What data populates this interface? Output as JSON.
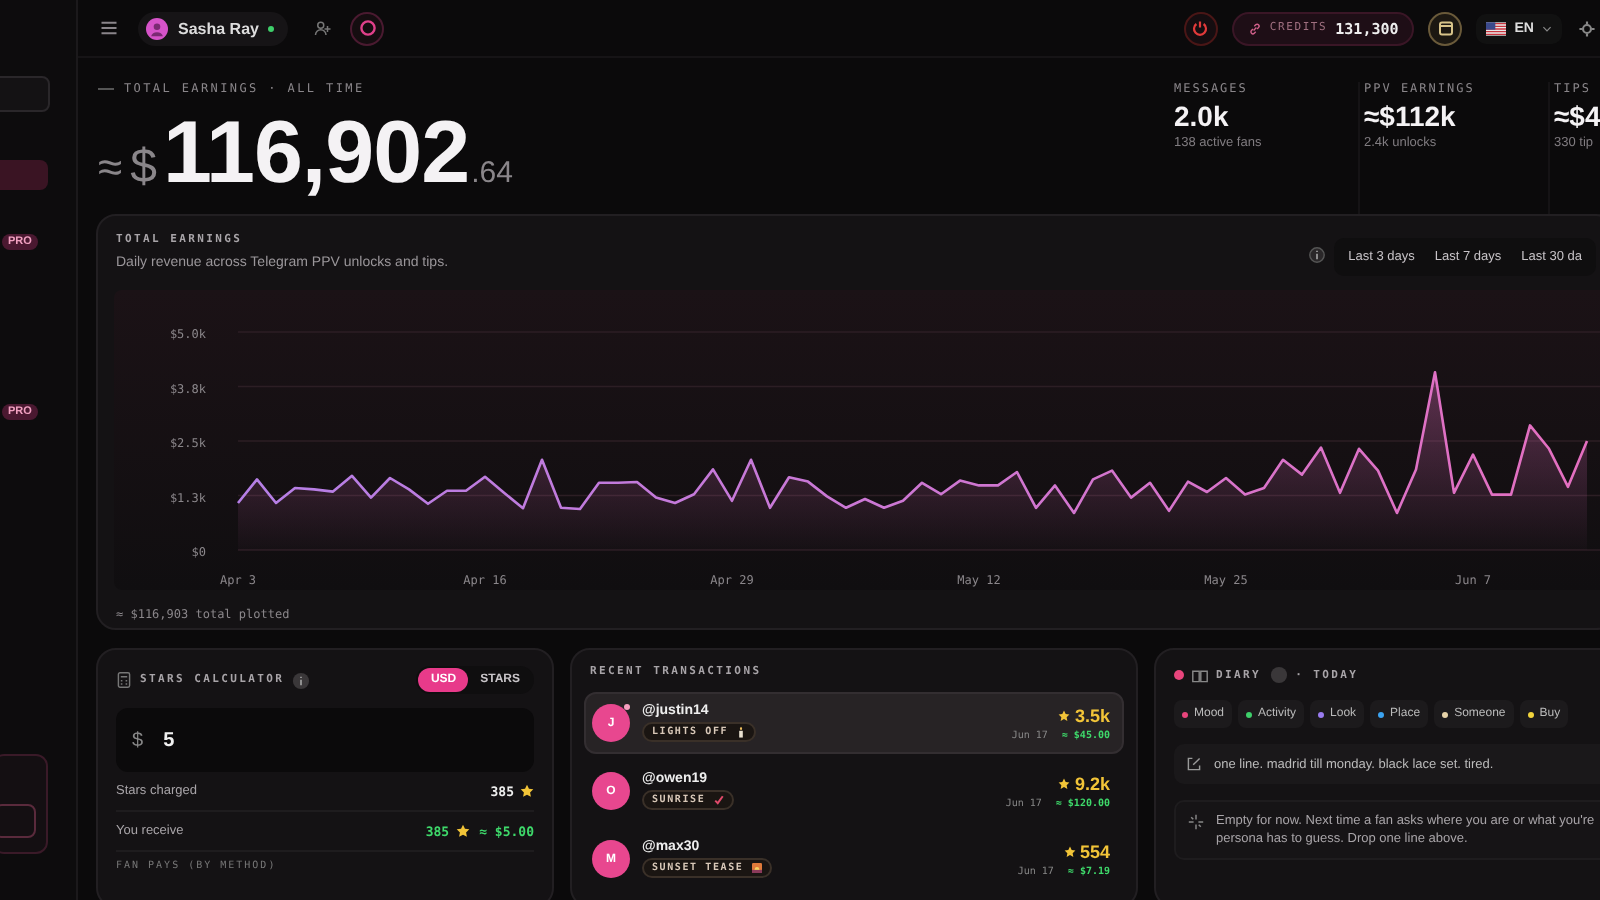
{
  "sidebar": {
    "badges": [
      "PRO",
      "PRO"
    ]
  },
  "topbar": {
    "user": {
      "name": "Sasha Ray",
      "online": true
    },
    "credits": {
      "label": "CREDITS",
      "value": "131,300"
    },
    "language": "EN"
  },
  "hero": {
    "label": "TOTAL EARNINGS · ALL TIME",
    "approx": "≈",
    "currency": "$",
    "whole": "116,902",
    "cents": ".64"
  },
  "stats": [
    {
      "label": "MESSAGES",
      "value": "2.0k",
      "note": "138 active fans"
    },
    {
      "label": "PPV EARNINGS",
      "value": "≈$112k",
      "note": "2.4k unlocks"
    },
    {
      "label": "TIPS",
      "value": "≈$4",
      "note": "330 tip"
    }
  ],
  "earnings": {
    "title": "TOTAL EARNINGS",
    "subtitle": "Daily revenue across Telegram PPV unlocks and tips.",
    "ranges": [
      {
        "label": "Last 3 days",
        "selected": false
      },
      {
        "label": "Last 7 days",
        "selected": false
      },
      {
        "label": "Last 30 da",
        "selected": false
      }
    ],
    "footer": "≈ $116,903 total plotted",
    "chart_data": {
      "type": "area",
      "ylim": [
        0,
        5000
      ],
      "grid": true,
      "categories": [
        "Apr 3",
        null,
        null,
        null,
        null,
        null,
        null,
        null,
        null,
        null,
        null,
        null,
        null,
        "Apr 16",
        null,
        null,
        null,
        null,
        null,
        null,
        null,
        null,
        null,
        null,
        null,
        null,
        "Apr 29",
        null,
        null,
        null,
        null,
        null,
        null,
        null,
        null,
        null,
        null,
        null,
        null,
        "May 12",
        null,
        null,
        null,
        null,
        null,
        null,
        null,
        null,
        null,
        null,
        null,
        null,
        "May 25",
        null,
        null,
        null,
        null,
        null,
        null,
        null,
        null,
        null,
        null,
        null,
        null,
        "Jun 7",
        null,
        null,
        null,
        null,
        null,
        null
      ],
      "yticks": [
        {
          "value": 0,
          "label": "$0"
        },
        {
          "value": 1250,
          "label": "$1.3k"
        },
        {
          "value": 2500,
          "label": "$2.5k"
        },
        {
          "value": 3750,
          "label": "$3.8k"
        },
        {
          "value": 5000,
          "label": "$5.0k"
        }
      ],
      "series": [
        {
          "color": "#e46fc0",
          "values": [
            1080,
            1620,
            1080,
            1420,
            1390,
            1340,
            1700,
            1200,
            1650,
            1390,
            1060,
            1360,
            1360,
            1680,
            1310,
            960,
            2070,
            970,
            940,
            1540,
            1540,
            1560,
            1200,
            1080,
            1280,
            1850,
            1130,
            2070,
            970,
            1670,
            1570,
            1230,
            970,
            1170,
            970,
            1130,
            1540,
            1280,
            1590,
            1480,
            1480,
            1790,
            970,
            1480,
            850,
            1620,
            1820,
            1200,
            1540,
            900,
            1570,
            1330,
            1650,
            1270,
            1420,
            2070,
            1730,
            2350,
            1310,
            2320,
            1820,
            850,
            1850,
            4080,
            1310,
            2190,
            1270,
            1270,
            2860,
            2320,
            1450,
            2500
          ]
        }
      ]
    }
  },
  "stars_calculator": {
    "title": "STARS CALCULATOR",
    "units": [
      {
        "label": "USD",
        "selected": true
      },
      {
        "label": "STARS",
        "selected": false
      }
    ],
    "input": {
      "prefix": "$",
      "value": "5"
    },
    "rows": [
      {
        "kind": "charged",
        "label": "Stars charged",
        "amount": "385"
      },
      {
        "kind": "receive",
        "label": "You receive",
        "amount": "385",
        "usd": "≈ $5.00"
      }
    ],
    "section": "FAN PAYS (BY METHOD)"
  },
  "transactions": {
    "title": "RECENT TRANSACTIONS",
    "rows": [
      {
        "initial": "J",
        "handle": "@justin14",
        "tag": "LIGHTS OFF",
        "amount": "3.5k",
        "date": "Jun 17",
        "usd": "≈ $45.00",
        "selected": true,
        "unread": true
      },
      {
        "initial": "O",
        "handle": "@owen19",
        "tag": "SUNRISE",
        "amount": "9.2k",
        "date": "Jun 17",
        "usd": "≈ $120.00",
        "selected": false,
        "unread": false
      },
      {
        "initial": "M",
        "handle": "@max30",
        "tag": "SUNSET TEASE",
        "amount": "554",
        "date": "Jun 17",
        "usd": "≈ $7.19",
        "selected": false,
        "unread": false
      }
    ]
  },
  "diary": {
    "title": "DIARY",
    "when": "· TODAY",
    "chips": [
      {
        "label": "Mood",
        "color": "#e8457c"
      },
      {
        "label": "Activity",
        "color": "#3ecf6a"
      },
      {
        "label": "Look",
        "color": "#9a7cf0"
      },
      {
        "label": "Place",
        "color": "#3ba3f0"
      },
      {
        "label": "Someone",
        "color": "#e6d2a8"
      },
      {
        "label": "Buy",
        "color": "#f2d33c"
      }
    ],
    "entry": "one line. madrid till monday. black lace set. tired.",
    "note_lines": [
      "Empty for now. Next time a fan asks where you are or what you're",
      "persona has to guess. Drop one line above."
    ]
  }
}
